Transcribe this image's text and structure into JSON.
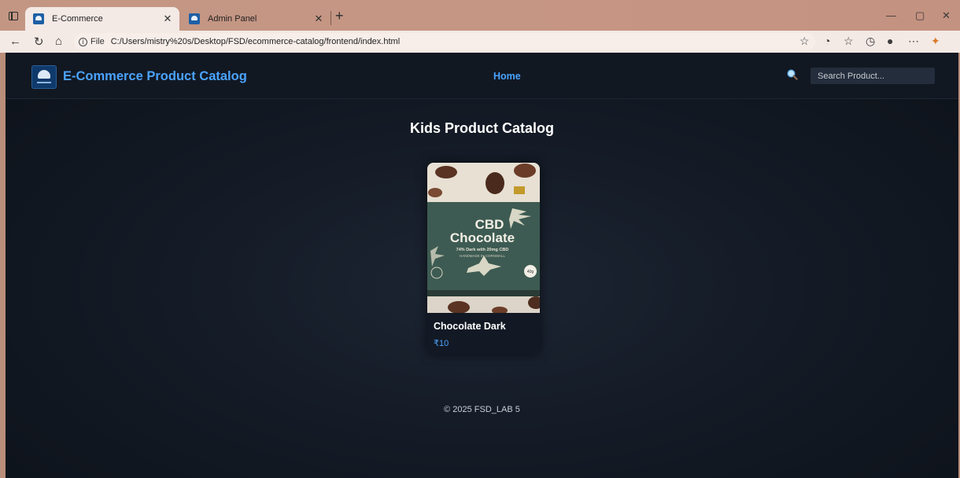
{
  "browser": {
    "tabs": [
      {
        "label": "E-Commerce",
        "active": true
      },
      {
        "label": "Admin Panel",
        "active": false
      }
    ],
    "address": {
      "scheme_label": "File",
      "url": "C:/Users/mistry%20s/Desktop/FSD/ecommerce-catalog/frontend/index.html"
    },
    "icons": {
      "back": "arrow-left",
      "refresh": "refresh",
      "home": "home",
      "favorite": "star",
      "extensions": "puzzle",
      "favorites": "favorites-list",
      "history": "history",
      "profile": "user",
      "more": "ellipsis",
      "copilot": "copilot"
    }
  },
  "header": {
    "brand": "E-Commerce Product Catalog",
    "nav": {
      "home": "Home"
    },
    "search": {
      "placeholder": "Search Product..."
    }
  },
  "main": {
    "title": "Kids Product Catalog",
    "products": [
      {
        "name": "Chocolate Dark",
        "price": "₹10",
        "image": {
          "line1": "CBD",
          "line2": "Chocolate",
          "line3": "74% Dark with 20mg CBD",
          "line4": "HANDMADE IN CORNWALL",
          "weight": "40g"
        }
      }
    ]
  },
  "footer": {
    "text": "© 2025 FSD_LAB 5"
  },
  "colors": {
    "accent": "#4aa3ff",
    "page_bg": "#141b26",
    "header_bg": "#121822",
    "tab_bar": "#c69684"
  }
}
